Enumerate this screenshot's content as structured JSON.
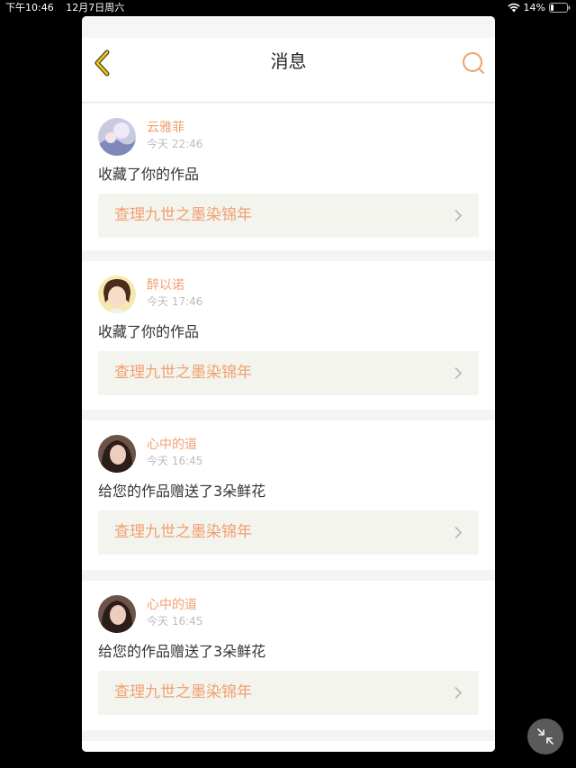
{
  "status_bar": {
    "time": "下午10:46",
    "date": "12月7日周六",
    "battery": "14%"
  },
  "nav": {
    "title": "消息"
  },
  "messages": [
    {
      "username": "云雅菲",
      "time": "今天 22:46",
      "action": "收藏了你的作品",
      "work_title": "查理九世之墨染锦年"
    },
    {
      "username": "醉以诺",
      "time": "今天 17:46",
      "action": "收藏了你的作品",
      "work_title": "查理九世之墨染锦年"
    },
    {
      "username": "心中的道",
      "time": "今天 16:45",
      "action": "给您的作品赠送了3朵鲜花",
      "work_title": "查理九世之墨染锦年"
    },
    {
      "username": "心中的道",
      "time": "今天 16:45",
      "action": "给您的作品赠送了3朵鲜花",
      "work_title": "查理九世之墨染锦年"
    }
  ],
  "colors": {
    "accent": "#f0a070",
    "back_arrow": "#d4a017"
  }
}
